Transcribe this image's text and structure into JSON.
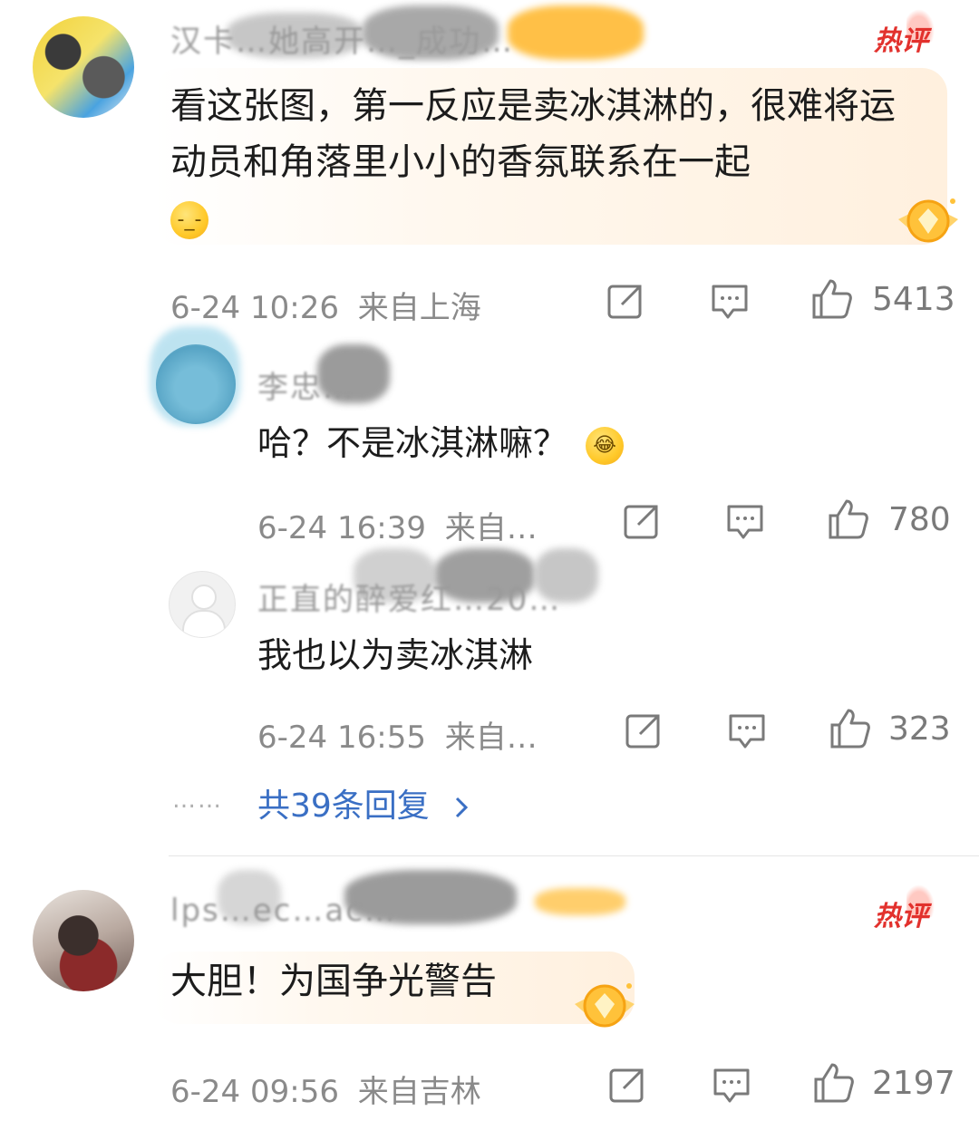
{
  "comments": [
    {
      "username": "汉卡…她高开…_成功…",
      "badge": "热评",
      "text": "看这张图，第一反应是卖冰淇淋的，很难将运动员和角落里小小的香氛联系在一起",
      "emoji": "-_-",
      "time": "6-24 10:26",
      "location": "来自上海",
      "likes": "5413",
      "replies": [
        {
          "username": "李忠…",
          "text": "哈？不是冰淇淋嘛？",
          "emoji": "😂",
          "time": "6-24 16:39",
          "location": "来自…",
          "likes": "780"
        },
        {
          "username": "正直的醉爱红…20…",
          "text": "我也以为卖冰淇淋",
          "time": "6-24 16:55",
          "location": "来自…",
          "likes": "323"
        }
      ],
      "more_replies": "共39条回复",
      "more_dots": "……"
    },
    {
      "username": "lps…ec…ac…",
      "badge": "热评",
      "text": "大胆！为国争光警告",
      "time": "6-24 09:56",
      "location": "来自吉林",
      "likes": "2197"
    }
  ],
  "icons": [
    "share-icon",
    "comment-icon",
    "like-icon",
    "chevron-right-icon",
    "medal-icon"
  ],
  "colors": {
    "hot_red": "#e2312d",
    "link_blue": "#3a6fc4",
    "meta_gray": "#8a8a8a"
  }
}
